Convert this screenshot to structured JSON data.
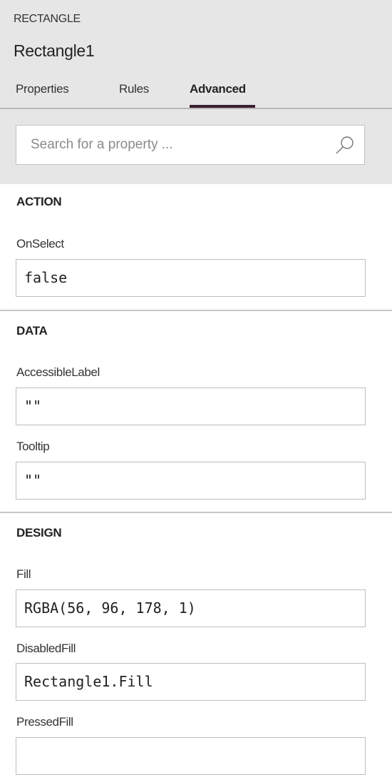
{
  "header": {
    "object_type": "RECTANGLE",
    "object_name": "Rectangle1",
    "tabs": [
      {
        "label": "Properties"
      },
      {
        "label": "Rules"
      },
      {
        "label": "Advanced",
        "active": true
      }
    ]
  },
  "search": {
    "placeholder": "Search for a property ...",
    "value": ""
  },
  "sections": {
    "action": {
      "title": "ACTION",
      "properties": [
        {
          "label": "OnSelect",
          "value": "false"
        }
      ]
    },
    "data": {
      "title": "DATA",
      "properties": [
        {
          "label": "AccessibleLabel",
          "value": "\"\""
        },
        {
          "label": "Tooltip",
          "value": "\"\""
        }
      ]
    },
    "design": {
      "title": "DESIGN",
      "properties": [
        {
          "label": "Fill",
          "value": "RGBA(56, 96, 178, 1)"
        },
        {
          "label": "DisabledFill",
          "value": "Rectangle1.Fill"
        },
        {
          "label": "PressedFill",
          "value": ""
        }
      ]
    }
  },
  "colors": {
    "header_bg": "#e6e6e6",
    "tab_underline": "#3a1f33"
  }
}
